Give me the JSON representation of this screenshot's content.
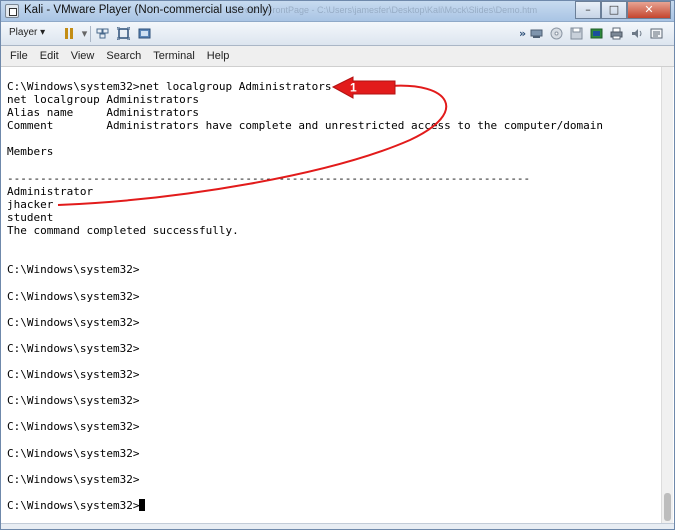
{
  "window": {
    "title": "Kali - VMware Player (Non-commercial use only)",
    "background_title": "Microsoft FrontPage - C:\\Users\\jamesfer\\Desktop\\Kali\\Mock\\Slides\\Demo.htm",
    "minimize": "–",
    "maximize": "□",
    "close": "✕"
  },
  "toolbar": {
    "player_label": "Player ▾",
    "icons": [
      "pause-icon",
      "send-ctrl-alt-del-icon",
      "fit-guest-icon",
      "unity-icon",
      "more-arrow-icon",
      "network-icon",
      "cd-icon",
      "floppy-icon",
      "usb-icon",
      "printer-icon",
      "sound-icon",
      "message-icon"
    ]
  },
  "menu": {
    "file": "File",
    "edit": "Edit",
    "view": "View",
    "search": "Search",
    "terminal": "Terminal",
    "help": "Help"
  },
  "terminal": {
    "lines": [
      "C:\\Windows\\system32>net localgroup Administrators",
      "net localgroup Administrators",
      "Alias name     Administrators",
      "Comment        Administrators have complete and unrestricted access to the computer/domain",
      "",
      "Members",
      "",
      "-------------------------------------------------------------------------------",
      "Administrator",
      "jhacker",
      "student",
      "The command completed successfully.",
      "",
      "",
      "C:\\Windows\\system32>",
      "",
      "C:\\Windows\\system32>",
      "",
      "C:\\Windows\\system32>",
      "",
      "C:\\Windows\\system32>",
      "",
      "C:\\Windows\\system32>",
      "",
      "C:\\Windows\\system32>",
      "",
      "C:\\Windows\\system32>",
      "",
      "C:\\Windows\\system32>",
      "",
      "C:\\Windows\\system32>",
      "",
      "C:\\Windows\\system32>"
    ]
  },
  "annotation": {
    "number": "1",
    "color": "#e21b1b"
  },
  "colors": {
    "titlebar": "#b9d0ea",
    "terminal_bg": "#ffffff",
    "terminal_text": "#000000"
  }
}
